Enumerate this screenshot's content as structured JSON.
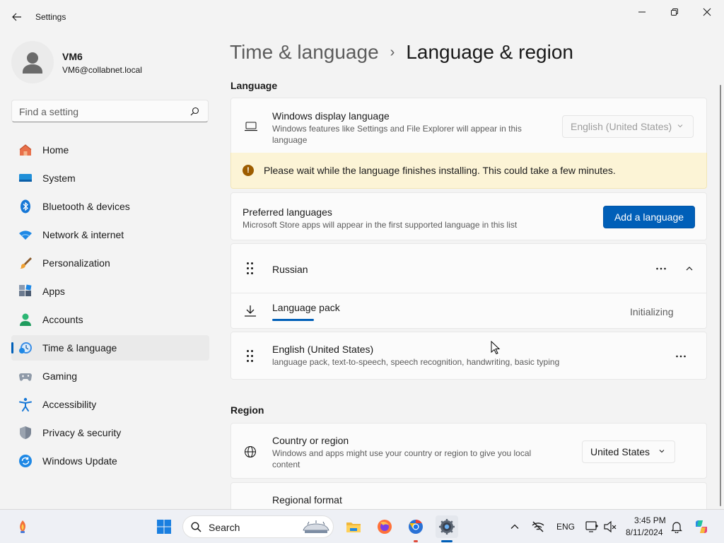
{
  "window": {
    "title": "Settings"
  },
  "profile": {
    "name": "VM6",
    "email": "VM6@collabnet.local"
  },
  "search": {
    "placeholder": "Find a setting"
  },
  "sidebar": {
    "items": [
      {
        "label": "Home",
        "icon": "home-icon"
      },
      {
        "label": "System",
        "icon": "system-icon"
      },
      {
        "label": "Bluetooth & devices",
        "icon": "bluetooth-icon"
      },
      {
        "label": "Network & internet",
        "icon": "wifi-icon"
      },
      {
        "label": "Personalization",
        "icon": "brush-icon"
      },
      {
        "label": "Apps",
        "icon": "apps-icon"
      },
      {
        "label": "Accounts",
        "icon": "accounts-icon"
      },
      {
        "label": "Time & language",
        "icon": "time-language-icon",
        "active": true
      },
      {
        "label": "Gaming",
        "icon": "gamepad-icon"
      },
      {
        "label": "Accessibility",
        "icon": "accessibility-icon"
      },
      {
        "label": "Privacy & security",
        "icon": "shield-icon"
      },
      {
        "label": "Windows Update",
        "icon": "update-icon"
      }
    ]
  },
  "breadcrumb": {
    "parent": "Time & language",
    "separator": "›",
    "current": "Language & region"
  },
  "language": {
    "section_title": "Language",
    "display": {
      "title": "Windows display language",
      "description": "Windows features like Settings and File Explorer will appear in this language",
      "dropdown_value": "English (United States)",
      "dropdown_disabled": true
    },
    "warning": "Please wait while the language finishes installing. This could take a few minutes.",
    "preferred": {
      "title": "Preferred languages",
      "description": "Microsoft Store apps will appear in the first supported language in this list",
      "add_button": "Add a language"
    },
    "languages": [
      {
        "name": "Russian",
        "expanded": true,
        "pack": {
          "label": "Language pack",
          "status": "Initializing",
          "progress": 0.11
        }
      },
      {
        "name": "English (United States)",
        "features": "language pack, text-to-speech, speech recognition, handwriting, basic typing"
      }
    ]
  },
  "region": {
    "section_title": "Region",
    "country": {
      "title": "Country or region",
      "description": "Windows and apps might use your country or region to give you local content",
      "value": "United States"
    },
    "format": {
      "title": "Regional format"
    }
  },
  "taskbar": {
    "search_placeholder": "Search",
    "input_language": "ENG",
    "time": "3:45 PM",
    "date": "8/11/2024"
  },
  "colors": {
    "accent": "#005fb8",
    "warning_bg": "#fcf4d6",
    "warning_icon": "#9d5d00",
    "window_bg": "#f3f3f3",
    "card_bg": "#fbfbfb"
  }
}
